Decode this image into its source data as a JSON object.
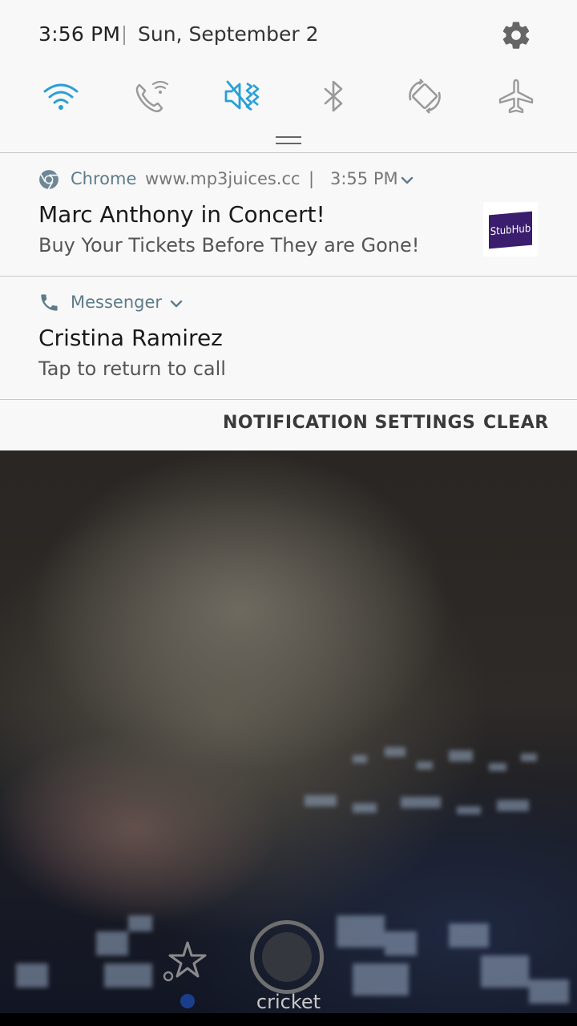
{
  "status_bar": {
    "time": "3:56 PM",
    "date": "Sun, September 2"
  },
  "quick_settings": [
    {
      "name": "wifi-icon",
      "active": true
    },
    {
      "name": "wifi-calling-icon",
      "active": false
    },
    {
      "name": "mute-vibrate-icon",
      "active": true
    },
    {
      "name": "bluetooth-icon",
      "active": false
    },
    {
      "name": "auto-rotate-icon",
      "active": false
    },
    {
      "name": "airplane-mode-icon",
      "active": false
    }
  ],
  "notifications": [
    {
      "app": "Chrome",
      "source": "www.mp3juices.cc",
      "separator": "|",
      "time": "3:55 PM",
      "title": "Marc Anthony in Concert!",
      "body": "Buy Your Tickets Before They are Gone!",
      "thumbnail_text": "StubHub"
    },
    {
      "app": "Messenger",
      "title": "Cristina Ramirez",
      "body": "Tap to return to call"
    }
  ],
  "actions": {
    "settings_label": "NOTIFICATION SETTINGS",
    "clear_label": "CLEAR"
  },
  "camera": {
    "shutter_label": "cricket"
  },
  "colors": {
    "accent_active": "#2a9fd6",
    "inactive_icon": "#9a9a9a",
    "panel_bg": "#f8f8f8",
    "app_label": "#5e7b8a"
  }
}
